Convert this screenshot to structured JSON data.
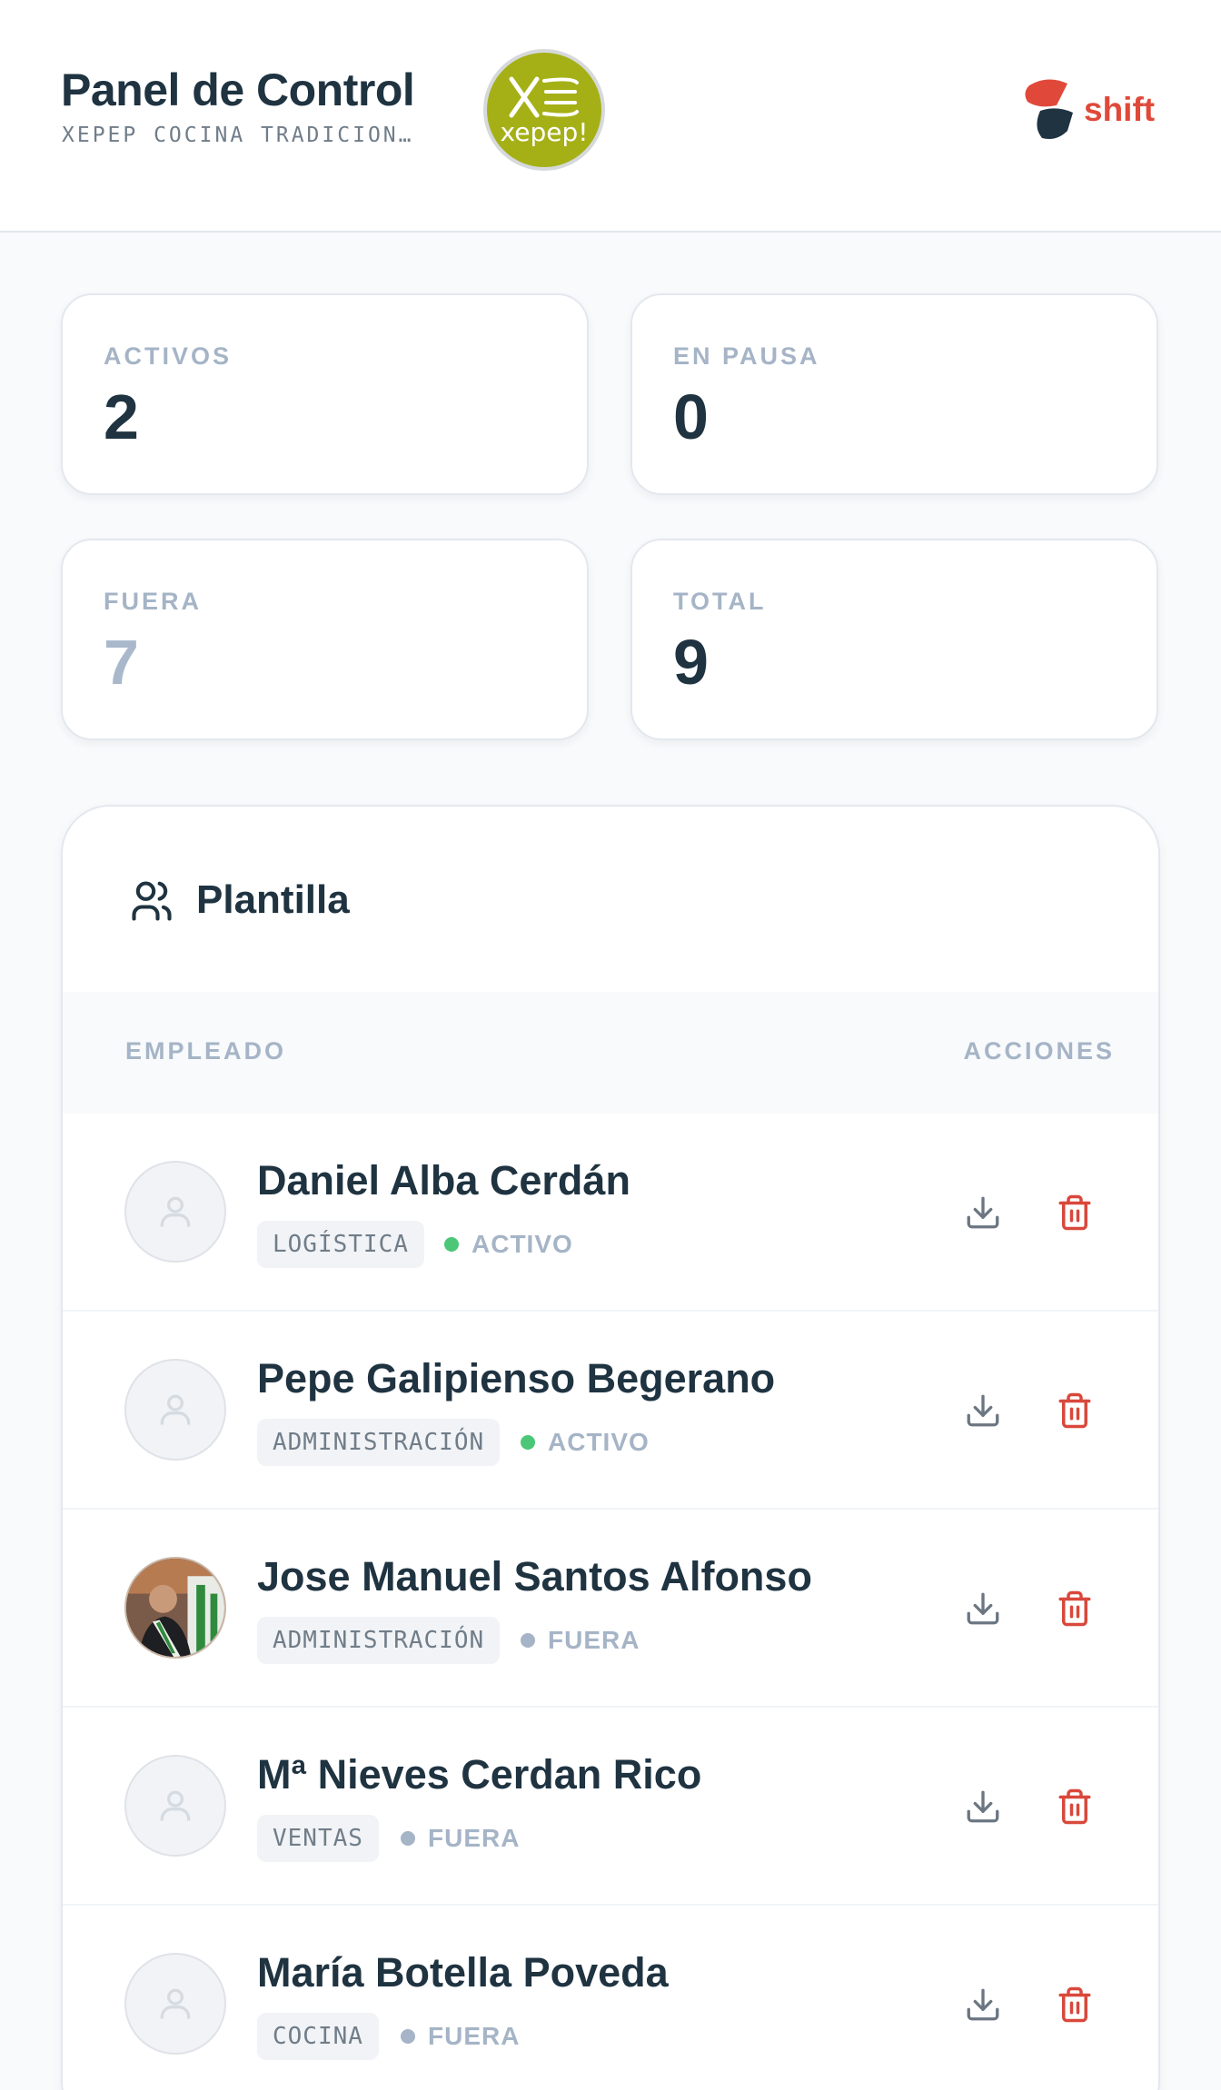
{
  "header": {
    "title": "Panel de Control",
    "subtitle": "XEPEP COCINA TRADICION…",
    "logo_text": "xepep!",
    "brand_text": "shift"
  },
  "stats": [
    {
      "label": "ACTIVOS",
      "value": "2"
    },
    {
      "label": "EN PAUSA",
      "value": "0"
    },
    {
      "label": "FUERA",
      "value": "7"
    },
    {
      "label": "TOTAL",
      "value": "9"
    }
  ],
  "staff": {
    "title": "Plantilla",
    "columns": {
      "employee": "EMPLEADO",
      "actions": "ACCIONES"
    },
    "employees": [
      {
        "name": "Daniel Alba Cerdán",
        "department": "LOGÍSTICA",
        "status": "ACTIVO"
      },
      {
        "name": "Pepe Galipienso Begerano",
        "department": "ADMINISTRACIÓN",
        "status": "ACTIVO"
      },
      {
        "name": "Jose Manuel Santos Alfonso",
        "department": "ADMINISTRACIÓN",
        "status": "FUERA"
      },
      {
        "name": "Mª Nieves Cerdan Rico",
        "department": "VENTAS",
        "status": "FUERA"
      },
      {
        "name": "María Botella Poveda",
        "department": "COCINA",
        "status": "FUERA"
      }
    ]
  },
  "colors": {
    "active": "#4cc777",
    "out": "#a5b4c6",
    "danger": "#d9483b",
    "brand_green": "#a5b016"
  }
}
